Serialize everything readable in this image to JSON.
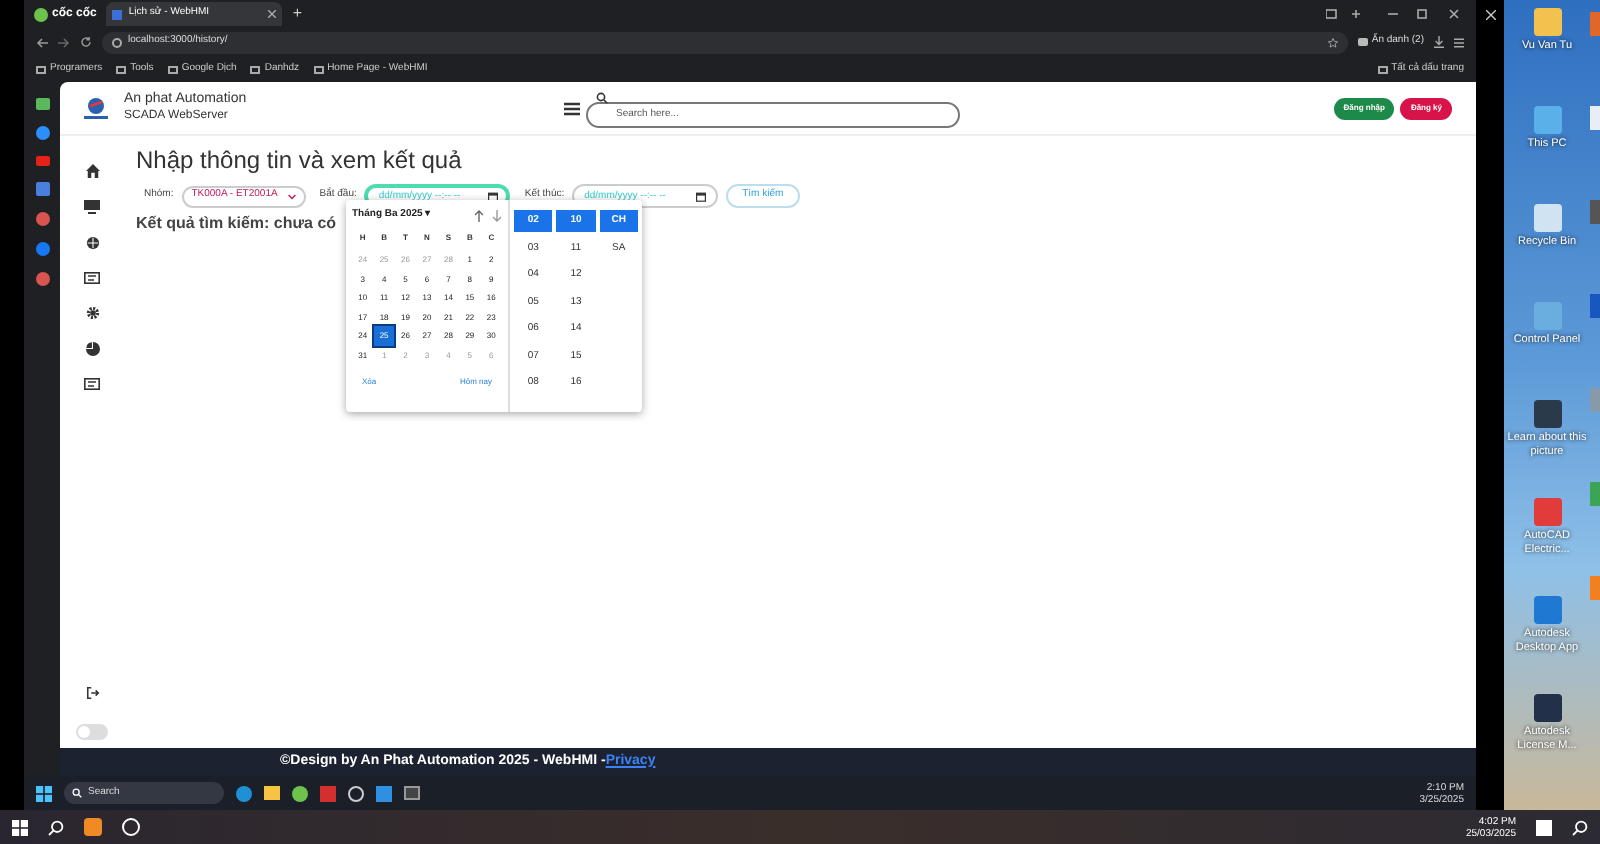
{
  "browser": {
    "brand": "cốc cốc",
    "tab": {
      "title": "Lịch sử - WebHMI",
      "selected": true
    },
    "new_tab": "+",
    "url": "localhost:3000/history/",
    "profile": "Ẩn danh (2)",
    "bookmarks": [
      "Programers",
      "Tools",
      "Google Dịch",
      "Danhdz",
      "Home Page - WebHMI"
    ],
    "all_bookmarks": "Tất cả dấu trang"
  },
  "header": {
    "brand_title": "An phat Automation",
    "brand_subtitle": "SCADA WebServer",
    "search": {
      "placeholder": "Search here..."
    },
    "buttons": [
      {
        "label": "Đăng nhập",
        "kind": "login"
      },
      {
        "label": "Đăng ký",
        "kind": "register"
      }
    ]
  },
  "sidebar": {
    "dark_mode": {
      "on": false
    }
  },
  "main": {
    "title": "Nhập thông tin và xem kết quả",
    "group_label": "Nhóm:",
    "group_value": "TK000A - ET2001A",
    "start_label": "Bắt đầu:",
    "start": {
      "placeholder": "dd/mm/yyyy --:-- --",
      "focused": true
    },
    "end_label": "Kết thúc:",
    "end": {
      "placeholder": "dd/mm/yyyy --:-- --",
      "focused": false
    },
    "search_button": "Tìm kiếm",
    "result": "Kết quả tìm kiếm: chưa có"
  },
  "date_picker": {
    "month": "Tháng Ba 2025 ▾",
    "weekdays": [
      "H",
      "B",
      "T",
      "N",
      "S",
      "B",
      "C"
    ],
    "days": [
      {
        "label": "24",
        "outside": true,
        "selected": false
      },
      {
        "label": "25",
        "outside": true,
        "selected": false
      },
      {
        "label": "26",
        "outside": true,
        "selected": false
      },
      {
        "label": "27",
        "outside": true,
        "selected": false
      },
      {
        "label": "28",
        "outside": true,
        "selected": false
      },
      {
        "label": "1",
        "outside": false,
        "selected": false
      },
      {
        "label": "2",
        "outside": false,
        "selected": false
      },
      {
        "label": "3",
        "outside": false,
        "selected": false
      },
      {
        "label": "4",
        "outside": false,
        "selected": false
      },
      {
        "label": "5",
        "outside": false,
        "selected": false
      },
      {
        "label": "6",
        "outside": false,
        "selected": false
      },
      {
        "label": "7",
        "outside": false,
        "selected": false
      },
      {
        "label": "8",
        "outside": false,
        "selected": false
      },
      {
        "label": "9",
        "outside": false,
        "selected": false
      },
      {
        "label": "10",
        "outside": false,
        "selected": false
      },
      {
        "label": "11",
        "outside": false,
        "selected": false
      },
      {
        "label": "12",
        "outside": false,
        "selected": false
      },
      {
        "label": "13",
        "outside": false,
        "selected": false
      },
      {
        "label": "14",
        "outside": false,
        "selected": false
      },
      {
        "label": "15",
        "outside": false,
        "selected": false
      },
      {
        "label": "16",
        "outside": false,
        "selected": false
      },
      {
        "label": "17",
        "outside": false,
        "selected": false
      },
      {
        "label": "18",
        "outside": false,
        "selected": false
      },
      {
        "label": "19",
        "outside": false,
        "selected": false
      },
      {
        "label": "20",
        "outside": false,
        "selected": false
      },
      {
        "label": "21",
        "outside": false,
        "selected": false
      },
      {
        "label": "22",
        "outside": false,
        "selected": false
      },
      {
        "label": "23",
        "outside": false,
        "selected": false
      },
      {
        "label": "24",
        "outside": false,
        "selected": false
      },
      {
        "label": "25",
        "outside": false,
        "selected": true
      },
      {
        "label": "26",
        "outside": false,
        "selected": false
      },
      {
        "label": "27",
        "outside": false,
        "selected": false
      },
      {
        "label": "28",
        "outside": false,
        "selected": false
      },
      {
        "label": "29",
        "outside": false,
        "selected": false
      },
      {
        "label": "30",
        "outside": false,
        "selected": false
      },
      {
        "label": "31",
        "outside": false,
        "selected": false
      },
      {
        "label": "1",
        "outside": true,
        "selected": false
      },
      {
        "label": "2",
        "outside": true,
        "selected": false
      },
      {
        "label": "3",
        "outside": true,
        "selected": false
      },
      {
        "label": "4",
        "outside": true,
        "selected": false
      },
      {
        "label": "5",
        "outside": true,
        "selected": false
      },
      {
        "label": "6",
        "outside": true,
        "selected": false
      }
    ],
    "clear": "Xóa",
    "today": "Hôm nay",
    "hours": [
      {
        "label": "02",
        "selected": true
      },
      {
        "label": "03",
        "selected": false
      },
      {
        "label": "04",
        "selected": false
      },
      {
        "label": "05",
        "selected": false
      },
      {
        "label": "06",
        "selected": false
      },
      {
        "label": "07",
        "selected": false
      },
      {
        "label": "08",
        "selected": false
      }
    ],
    "minutes": [
      {
        "label": "10",
        "selected": true
      },
      {
        "label": "11",
        "selected": false
      },
      {
        "label": "12",
        "selected": false
      },
      {
        "label": "13",
        "selected": false
      },
      {
        "label": "14",
        "selected": false
      },
      {
        "label": "15",
        "selected": false
      },
      {
        "label": "16",
        "selected": false
      }
    ],
    "periods": [
      {
        "label": "CH",
        "selected": true
      },
      {
        "label": "SA",
        "selected": false
      }
    ]
  },
  "footer": {
    "text": "©Design by An Phat Automation 2025 - WebHMI -",
    "link": "Privacy"
  },
  "remote_taskbar": {
    "search": "Search",
    "time": "2:10 PM",
    "date": "3/25/2025"
  },
  "desktop": {
    "icons": [
      {
        "label": "Vu Van Tu"
      },
      {
        "label": "This PC"
      },
      {
        "label": "Recycle Bin"
      },
      {
        "label": "Control Panel"
      },
      {
        "label": "Learn about this picture"
      },
      {
        "label": "AutoCAD Electric..."
      },
      {
        "label": "Autodesk Desktop App"
      },
      {
        "label": "Autodesk License M..."
      }
    ]
  },
  "taskbar": {
    "time": "4:02 PM",
    "date": "25/03/2025"
  }
}
